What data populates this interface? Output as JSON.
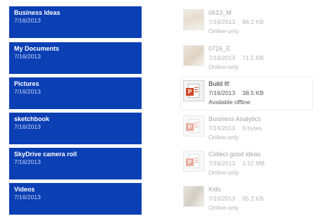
{
  "folders": [
    {
      "name": "Business Ideas",
      "date": "7/16/2013"
    },
    {
      "name": "My Documents",
      "date": "7/16/2013"
    },
    {
      "name": "Pictures",
      "date": "7/16/2013"
    },
    {
      "name": "sketchbook",
      "date": "7/16/2013"
    },
    {
      "name": "SkyDrive camera roll",
      "date": "7/16/2013"
    },
    {
      "name": "Videos",
      "date": "7/16/2013"
    }
  ],
  "files": [
    {
      "name": "0613_M",
      "date": "7/16/2013",
      "size": "86.2 KB",
      "status": "Online-only",
      "icon": "photo-thumbnail-icon"
    },
    {
      "name": "0716_E",
      "date": "7/16/2013",
      "size": "71.5 KB",
      "status": "Online-only",
      "icon": "photo-thumbnail-icon"
    },
    {
      "name": "Build It!",
      "date": "7/16/2013",
      "size": "38.5 KB",
      "status": "Available offline",
      "icon": "powerpoint-file-icon"
    },
    {
      "name": "Business Analytics",
      "date": "7/16/2013",
      "size": "0 bytes",
      "status": "Online-only",
      "icon": "powerpoint-file-icon"
    },
    {
      "name": "Collect good ideas",
      "date": "7/16/2013",
      "size": "1.52 MB",
      "status": "Online-only",
      "icon": "powerpoint-file-icon"
    },
    {
      "name": "Kids",
      "date": "7/16/2013",
      "size": "65.2 KB",
      "status": "Online-only",
      "icon": "photo-thumbnail-icon"
    }
  ],
  "colors": {
    "folder_tile": "#0b3fb4",
    "ppt_accent": "#d24726"
  }
}
